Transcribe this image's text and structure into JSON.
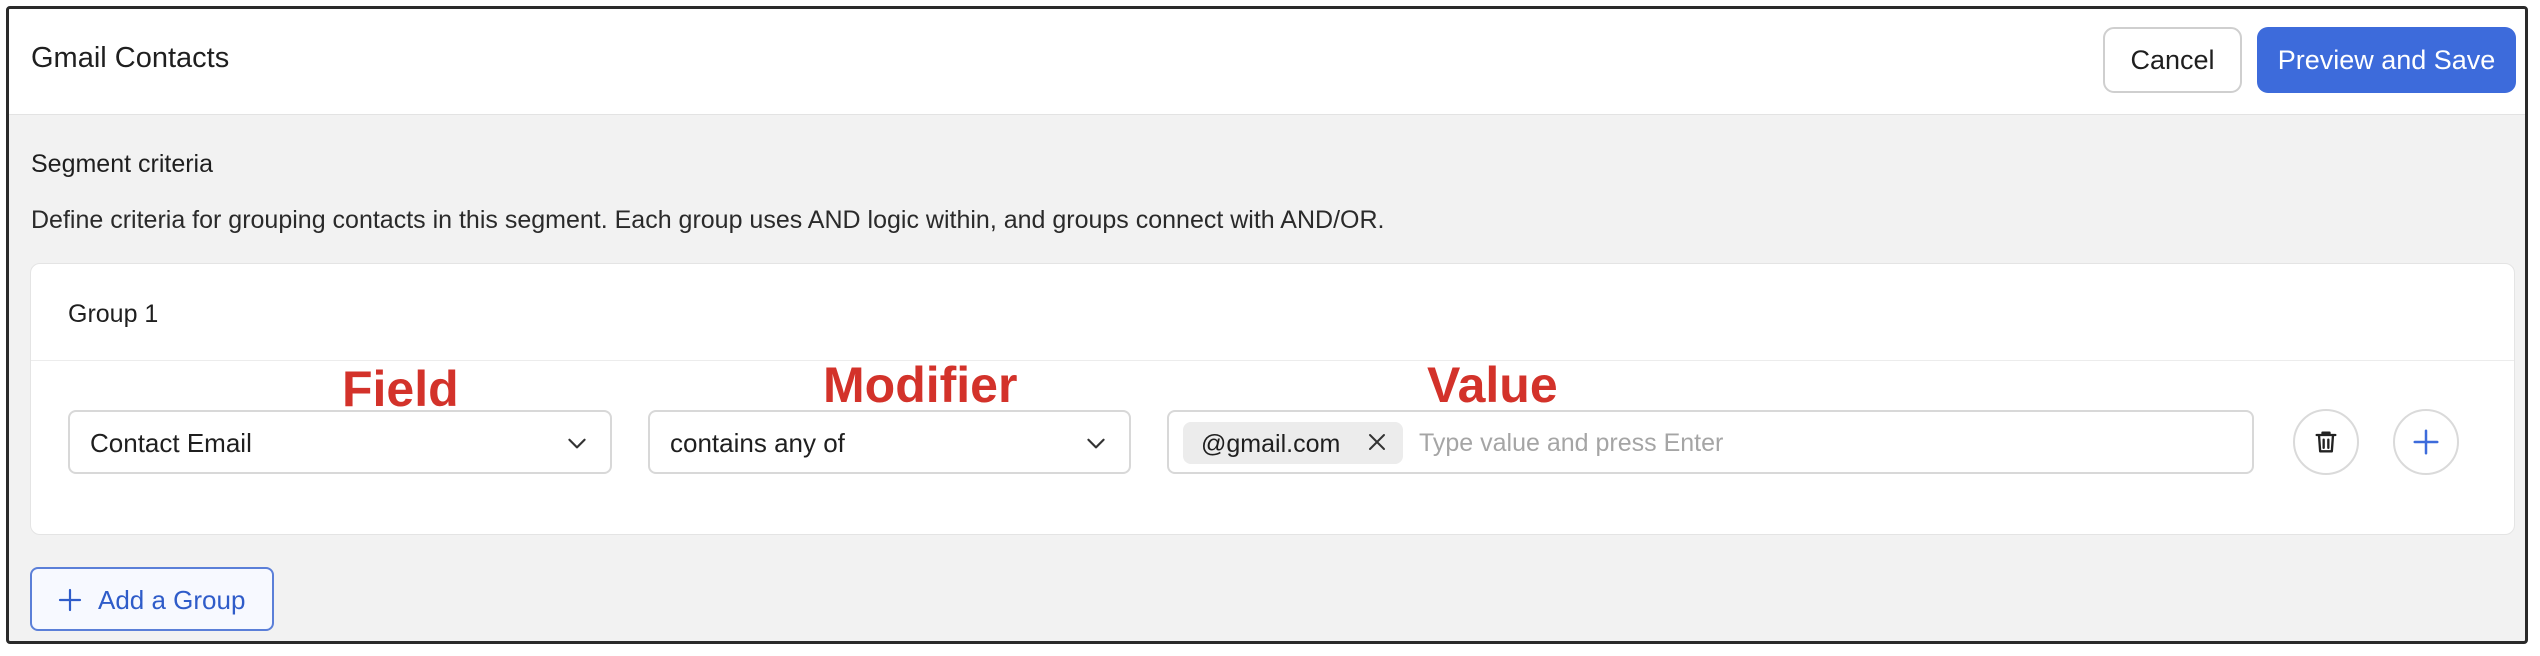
{
  "header": {
    "title": "Gmail Contacts",
    "cancel_label": "Cancel",
    "save_label": "Preview and Save"
  },
  "segment": {
    "title": "Segment criteria",
    "description": "Define criteria for grouping contacts in this segment. Each group uses AND logic within, and groups connect with AND/OR."
  },
  "annotations": {
    "field": "Field",
    "modifier": "Modifier",
    "value": "Value"
  },
  "groups": [
    {
      "label": "Group 1",
      "criteria": [
        {
          "field": "Contact Email",
          "modifier": "contains any of",
          "values": [
            "@gmail.com"
          ],
          "value_placeholder": "Type value and press Enter"
        }
      ]
    }
  ],
  "footer": {
    "add_group_label": "Add a Group"
  },
  "colors": {
    "primary": "#3d6bdb",
    "annotation": "#d3322a",
    "background": "#f2f2f2"
  },
  "icons": {
    "dropdown": "chevron-down-icon",
    "remove_chip": "close-icon",
    "delete": "trash-icon",
    "add": "plus-icon"
  }
}
